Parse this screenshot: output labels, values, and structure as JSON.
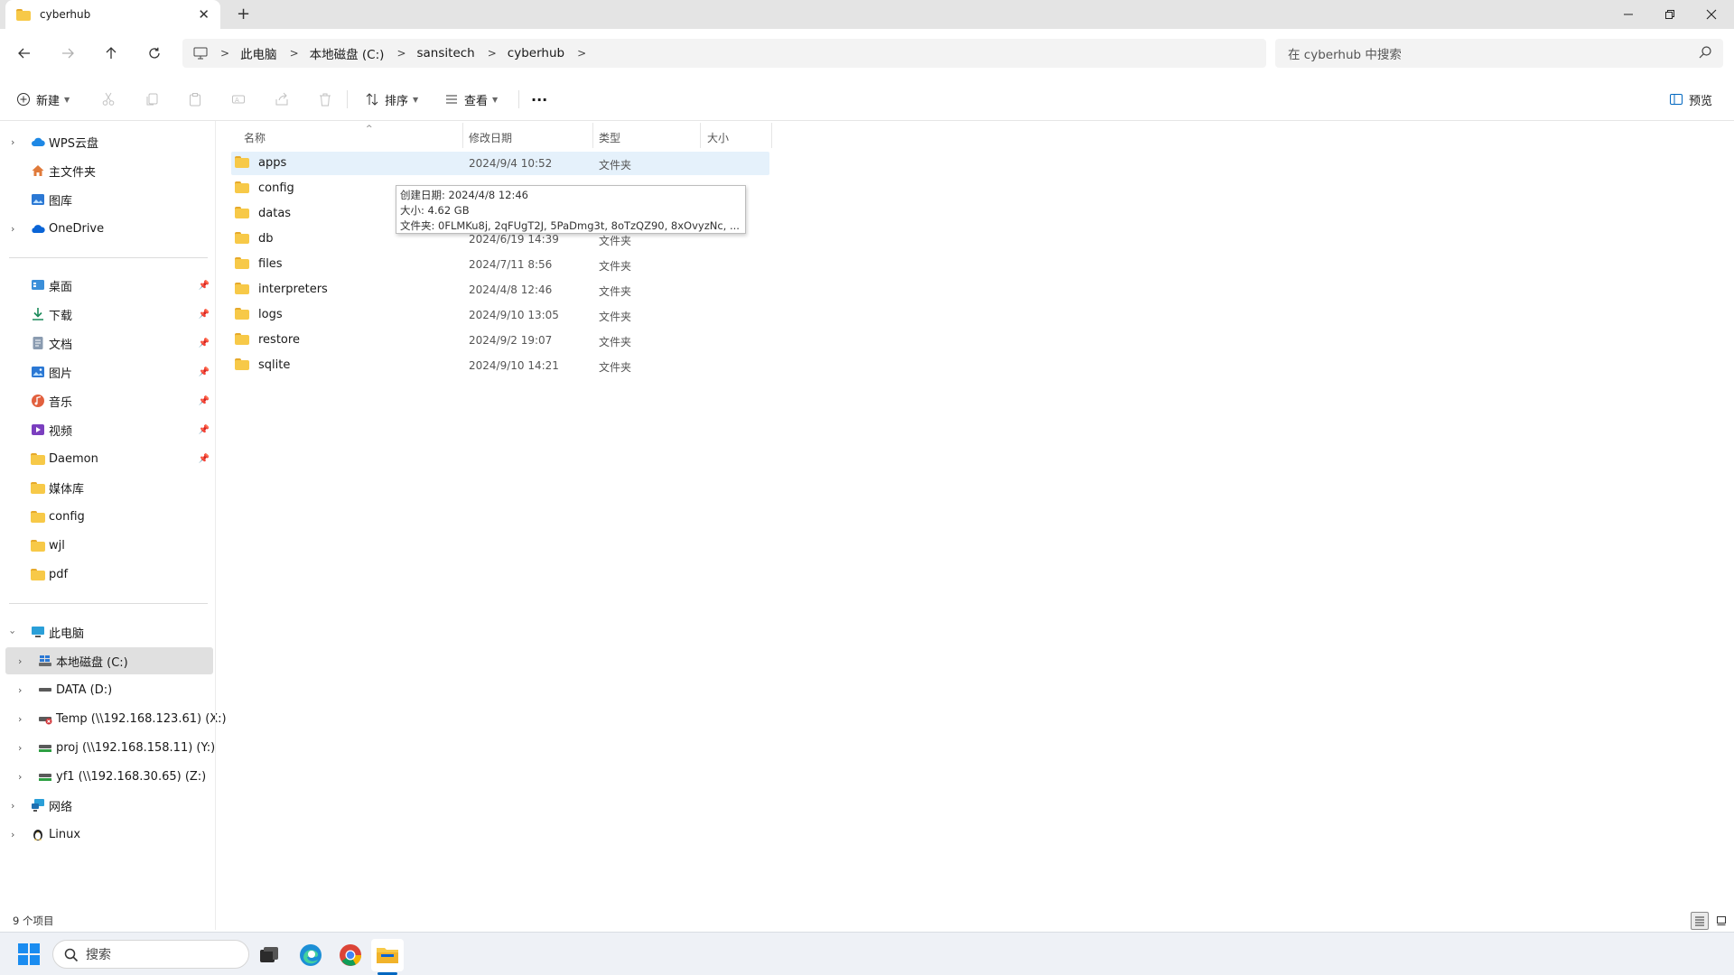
{
  "window": {
    "tab_title": "cyberhub",
    "new_tab_symbol": "+",
    "close_symbol": "✕"
  },
  "address": {
    "crumbs": [
      "此电脑",
      "本地磁盘 (C:)",
      "sansitech",
      "cyberhub"
    ],
    "search_placeholder": "在 cyberhub 中搜索"
  },
  "commands": {
    "new_label": "新建",
    "sort_label": "排序",
    "view_label": "查看",
    "more_label": "···",
    "preview_label": "预览"
  },
  "sidebar": {
    "top_items": [
      {
        "label": "WPS云盘",
        "icon": "cloud-icon",
        "expandable": true
      },
      {
        "label": "主文件夹",
        "icon": "home-icon",
        "expandable": false
      },
      {
        "label": "图库",
        "icon": "gallery-icon",
        "expandable": false
      },
      {
        "label": "OneDrive",
        "icon": "onedrive-icon",
        "expandable": true
      }
    ],
    "pinned_items": [
      {
        "label": "桌面",
        "icon": "desktop-icon",
        "pinned": true
      },
      {
        "label": "下载",
        "icon": "download-icon",
        "pinned": true
      },
      {
        "label": "文档",
        "icon": "document-icon",
        "pinned": true
      },
      {
        "label": "图片",
        "icon": "picture-icon",
        "pinned": true
      },
      {
        "label": "音乐",
        "icon": "music-icon",
        "pinned": true
      },
      {
        "label": "视频",
        "icon": "video-icon",
        "pinned": true
      },
      {
        "label": "Daemon",
        "icon": "folder-icon",
        "pinned": true
      },
      {
        "label": "媒体库",
        "icon": "folder-icon",
        "pinned": false
      },
      {
        "label": "config",
        "icon": "folder-icon",
        "pinned": false
      },
      {
        "label": "wjl",
        "icon": "folder-icon",
        "pinned": false
      },
      {
        "label": "pdf",
        "icon": "folder-icon",
        "pinned": false
      }
    ],
    "this_pc": "此电脑",
    "drives": [
      {
        "label": "本地磁盘 (C:)",
        "icon": "drive-c-icon",
        "selected": true
      },
      {
        "label": "DATA (D:)",
        "icon": "drive-icon",
        "selected": false
      },
      {
        "label": "Temp (\\\\192.168.123.61) (X:)",
        "icon": "network-drive-error-icon",
        "selected": false
      },
      {
        "label": "proj (\\\\192.168.158.11) (Y:)",
        "icon": "network-drive-icon",
        "selected": false
      },
      {
        "label": "yf1 (\\\\192.168.30.65) (Z:)",
        "icon": "network-drive-icon",
        "selected": false
      }
    ],
    "network": "网络",
    "linux": "Linux"
  },
  "columns": {
    "name": "名称",
    "modified": "修改日期",
    "type": "类型",
    "size": "大小"
  },
  "files": [
    {
      "name": "apps",
      "date": "2024/9/4 10:52",
      "type": "文件夹",
      "selected": true
    },
    {
      "name": "config",
      "date": "",
      "type": "",
      "selected": false
    },
    {
      "name": "datas",
      "date": "",
      "type": "",
      "selected": false
    },
    {
      "name": "db",
      "date": "2024/6/19 14:39",
      "type": "文件夹",
      "selected": false
    },
    {
      "name": "files",
      "date": "2024/7/11 8:56",
      "type": "文件夹",
      "selected": false
    },
    {
      "name": "interpreters",
      "date": "2024/4/8 12:46",
      "type": "文件夹",
      "selected": false
    },
    {
      "name": "logs",
      "date": "2024/9/10 13:05",
      "type": "文件夹",
      "selected": false
    },
    {
      "name": "restore",
      "date": "2024/9/2 19:07",
      "type": "文件夹",
      "selected": false
    },
    {
      "name": "sqlite",
      "date": "2024/9/10 14:21",
      "type": "文件夹",
      "selected": false
    }
  ],
  "tooltip": {
    "created": "创建日期: 2024/4/8 12:46",
    "size": "大小: 4.62 GB",
    "contents": "文件夹: 0FLMKu8j, 2qFUgT2J, 5PaDmg3t, 8oTzQZ90, 8xOvyzNc, ..."
  },
  "status": {
    "item_count": "9 个项目"
  },
  "taskbar": {
    "search_label": "搜索",
    "accent": "#0067c0"
  }
}
